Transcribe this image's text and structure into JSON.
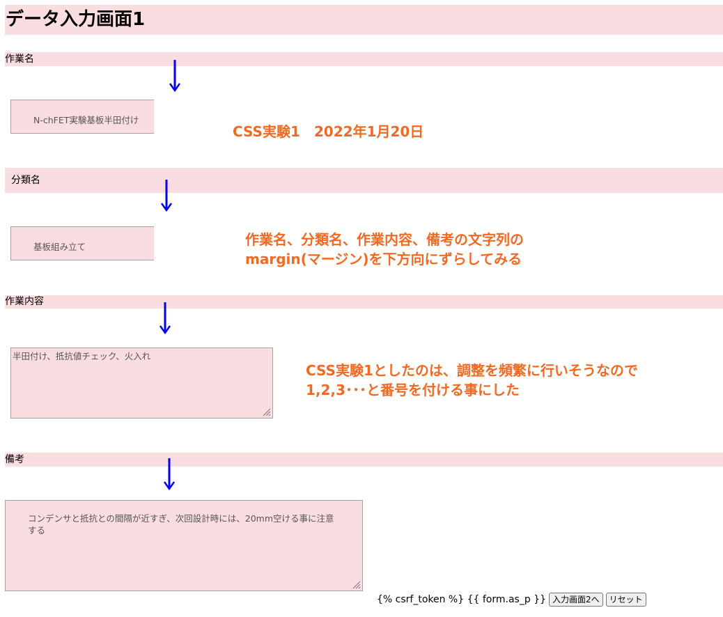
{
  "page": {
    "title": "データ入力画面1"
  },
  "form": {
    "task_name": {
      "label": "作業名",
      "value": "N-chFET実験基板半田付け"
    },
    "category": {
      "label": "分類名",
      "value": "基板組み立て"
    },
    "task_detail": {
      "label": "作業内容",
      "value": "半田付け、抵抗値チェック、火入れ"
    },
    "remarks": {
      "label": "備考",
      "value": "コンデンサと抵抗との間隔が近すぎ、次回設計時には、20mm空ける事に注意する"
    }
  },
  "notes": {
    "note1": "CSS実験1　2022年1月20日",
    "note2_line1": "作業名、分類名、作業内容、備考の文字列の",
    "note2_line2": "margin(マージン)を下方向にずらしてみる",
    "note3_line1": "CSS実験1としたのは、調整を頻繁に行いそうなので",
    "note3_line2": "1,2,3･･･と番号を付ける事にした"
  },
  "footer": {
    "template_text": "{% csrf_token %} {{ form.as_p }}",
    "next_button": "入力画面2へ",
    "reset_button": "リセット"
  },
  "colors": {
    "band": "#f9dde1",
    "arrow": "#0000ee",
    "note": "#f26a22"
  },
  "icons": {
    "arrow": "down-arrow-icon",
    "resize": "resize-grip-icon"
  }
}
